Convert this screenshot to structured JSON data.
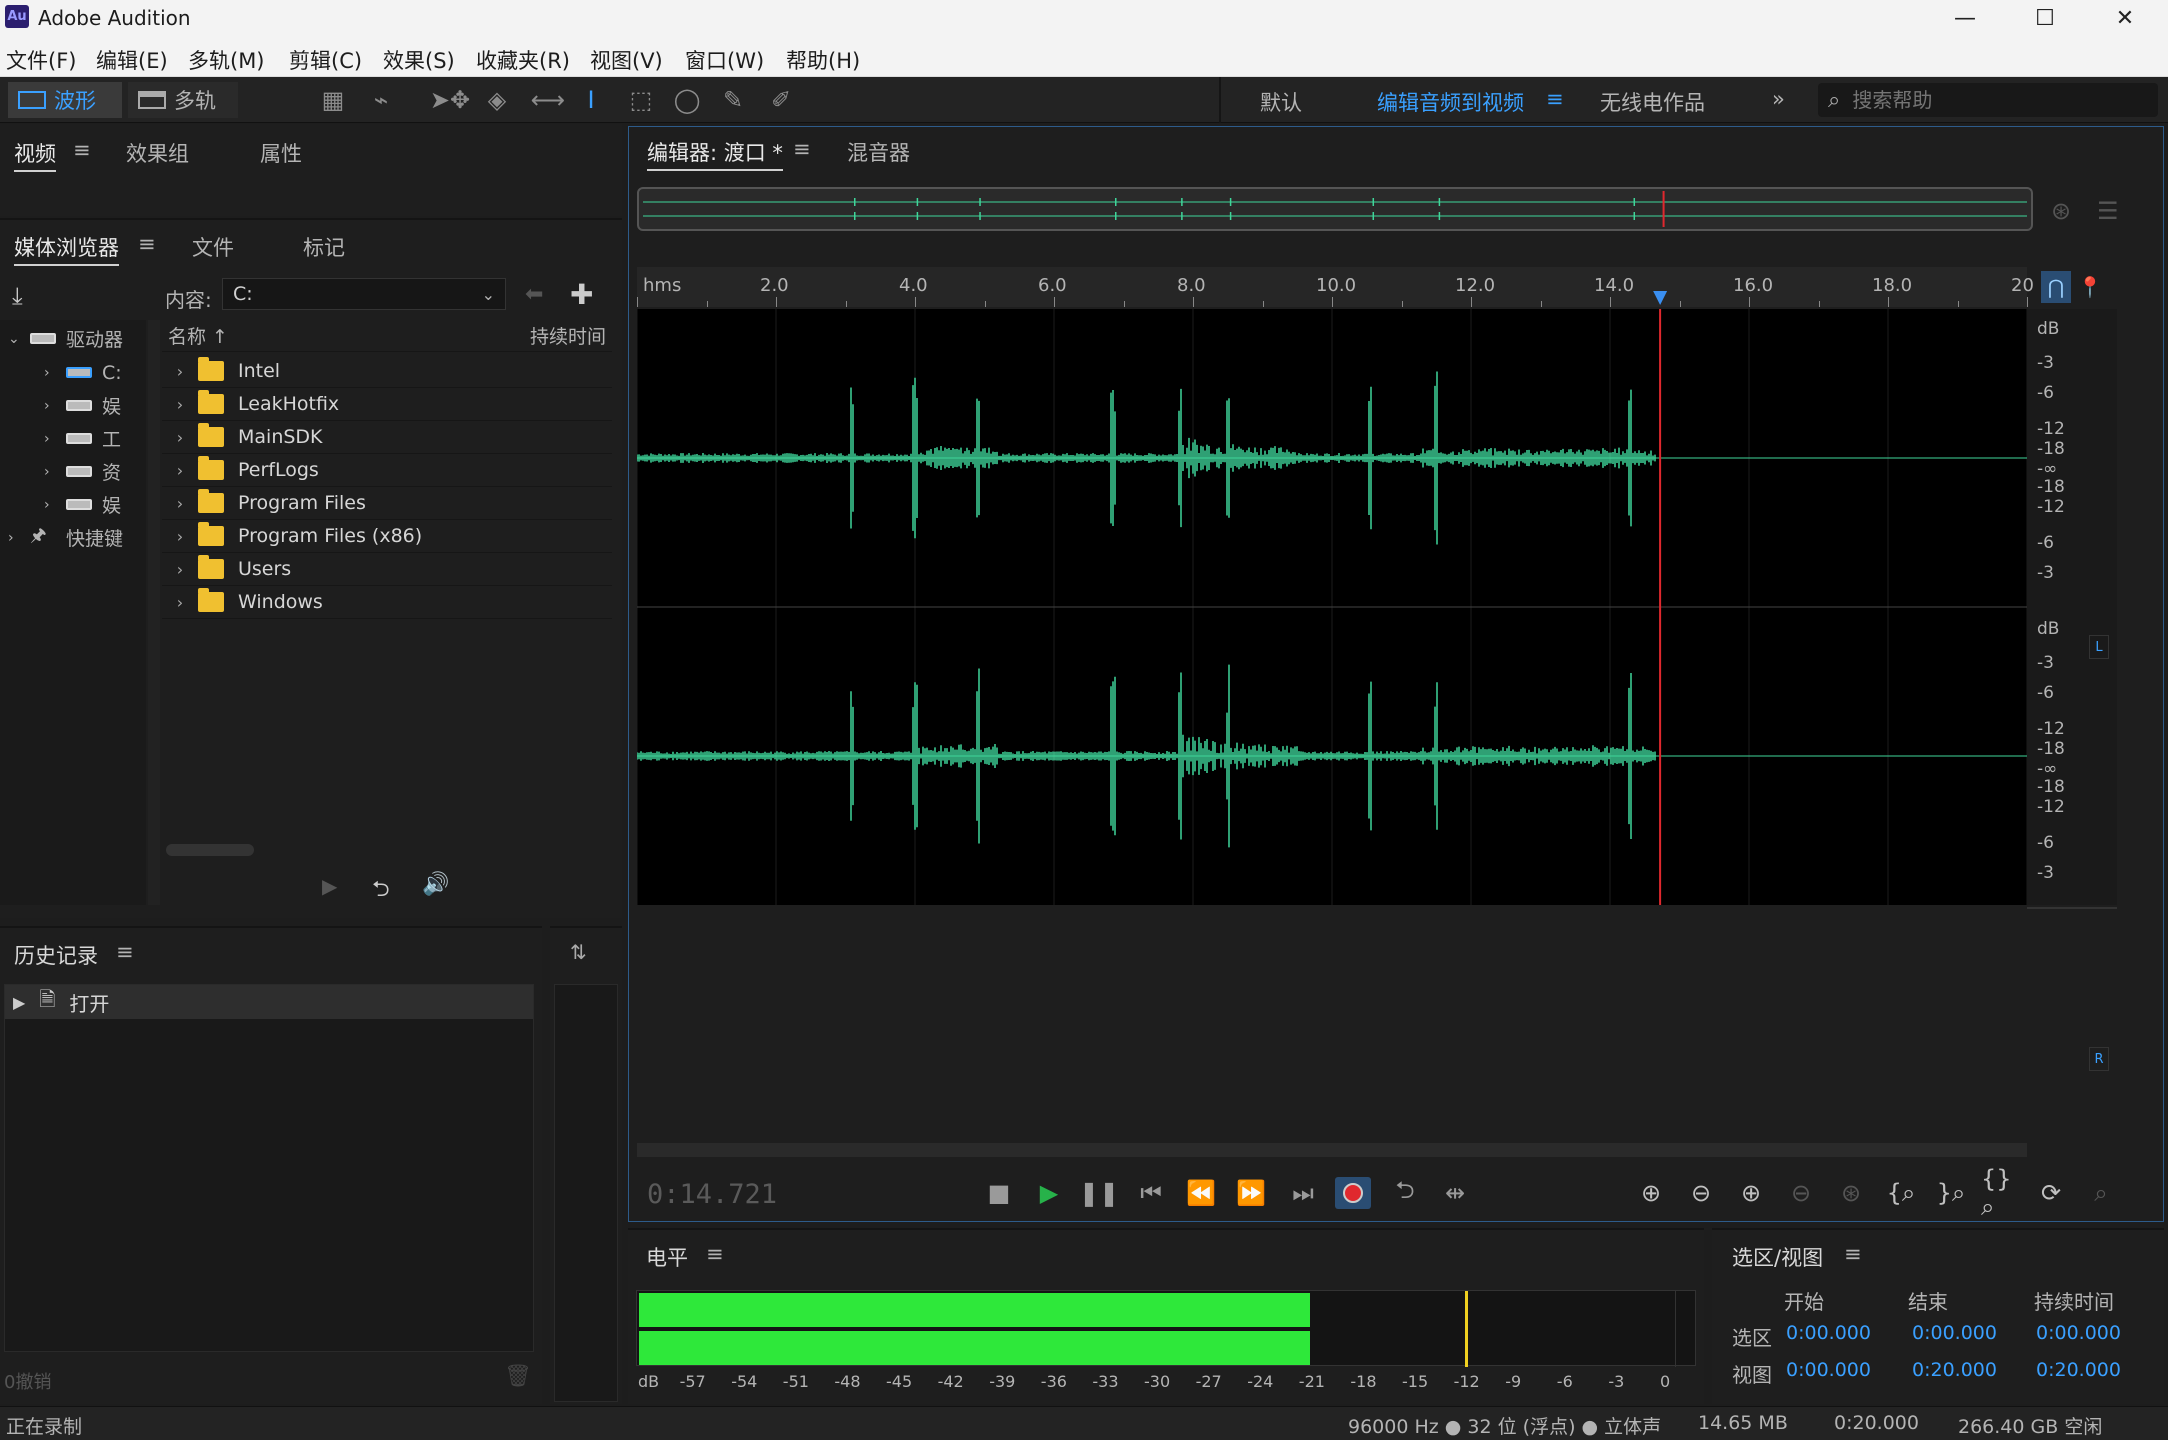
{
  "window": {
    "app_badge": "Au",
    "title": "Adobe Audition"
  },
  "menu": [
    "文件(F)",
    "编辑(E)",
    "多轨(M)",
    "剪辑(C)",
    "效果(S)",
    "收藏夹(R)",
    "视图(V)",
    "窗口(W)",
    "帮助(H)"
  ],
  "toolbar": {
    "waveform_label": "波形",
    "multitrack_label": "多轨",
    "workspaces": [
      "默认",
      "编辑音频到视频",
      "无线电作品"
    ],
    "active_workspace": "编辑音频到视频",
    "search_placeholder": "搜索帮助"
  },
  "top_left_panel": {
    "tabs": [
      "视频",
      "效果组",
      "属性"
    ],
    "active": "视频"
  },
  "media_browser": {
    "tabs": [
      "媒体浏览器",
      "文件",
      "标记"
    ],
    "content_label": "内容:",
    "content_value": "C:",
    "tree": [
      {
        "label": "驱动器",
        "expanded": true
      },
      {
        "label": "C:"
      },
      {
        "label": "娱"
      },
      {
        "label": "工"
      },
      {
        "label": "资"
      },
      {
        "label": "娱"
      },
      {
        "label": "快捷键"
      }
    ],
    "columns": {
      "name": "名称",
      "duration": "持续时间"
    },
    "files": [
      "Intel",
      "LeakHotfix",
      "MainSDK",
      "PerfLogs",
      "Program Files",
      "Program Files (x86)",
      "Users",
      "Windows"
    ]
  },
  "history": {
    "title": "历史记录",
    "items": [
      "打开"
    ],
    "undo_label": "0撤销"
  },
  "editor": {
    "tab_label": "编辑器: 渡口 *",
    "mixer_label": "混音器",
    "ruler_unit": "hms",
    "ruler_ticks": [
      "2.0",
      "4.0",
      "6.0",
      "8.0",
      "10.0",
      "12.0",
      "14.0",
      "16.0",
      "18.0",
      "20"
    ],
    "db_scale": [
      "dB",
      "-3",
      "-6",
      "-12",
      "-18",
      "-∞",
      "-18",
      "-12",
      "-6",
      "-3"
    ],
    "channel_left": "L",
    "channel_right": "R",
    "time_display": "0:14.721",
    "playhead_seconds": 14.721,
    "view_seconds": 20.0,
    "audio_end_seconds": 14.65,
    "waveform_color": "#3fd69a",
    "playhead_color": "#e0282e"
  },
  "levels": {
    "title": "电平",
    "scale": [
      "dB",
      "-57",
      "-54",
      "-51",
      "-48",
      "-45",
      "-42",
      "-39",
      "-36",
      "-33",
      "-30",
      "-27",
      "-24",
      "-21",
      "-18",
      "-15",
      "-12",
      "-9",
      "-6",
      "-3",
      "0"
    ],
    "level_db": -21,
    "peak_db": -12,
    "bar_color": "#2ee83a"
  },
  "selection_view": {
    "title": "选区/视图",
    "headers": [
      "开始",
      "结束",
      "持续时间"
    ],
    "rows": [
      {
        "label": "选区",
        "start": "0:00.000",
        "end": "0:00.000",
        "duration": "0:00.000"
      },
      {
        "label": "视图",
        "start": "0:00.000",
        "end": "0:20.000",
        "duration": "0:20.000"
      }
    ]
  },
  "status_bar": {
    "left": "正在录制",
    "format": "96000 Hz ● 32 位 (浮点) ● 立体声",
    "size": "14.65 MB",
    "duration": "0:20.000",
    "free_space": "266.40 GB 空闲"
  }
}
